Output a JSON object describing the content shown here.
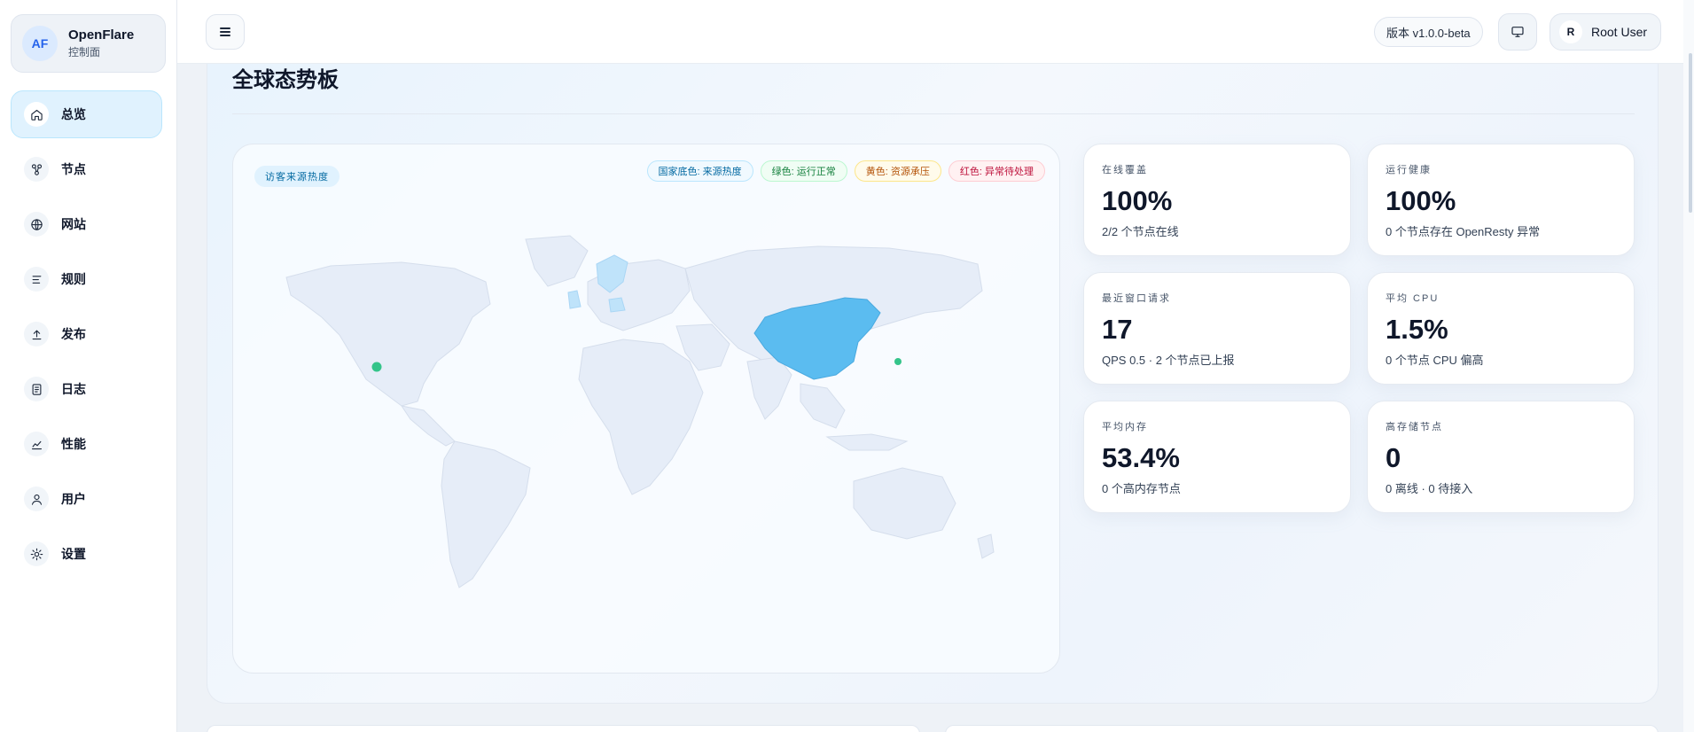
{
  "brand": {
    "avatar": "AF",
    "name": "OpenFlare",
    "subtitle": "控制面"
  },
  "sidebar": {
    "items": [
      {
        "label": "总览",
        "icon": "home-icon",
        "active": true
      },
      {
        "label": "节点",
        "icon": "nodes-icon"
      },
      {
        "label": "网站",
        "icon": "globe-icon"
      },
      {
        "label": "规则",
        "icon": "list-icon"
      },
      {
        "label": "发布",
        "icon": "upload-icon"
      },
      {
        "label": "日志",
        "icon": "document-icon"
      },
      {
        "label": "性能",
        "icon": "chart-line-icon"
      },
      {
        "label": "用户",
        "icon": "user-icon"
      },
      {
        "label": "设置",
        "icon": "gear-icon"
      }
    ]
  },
  "topbar": {
    "menu_icon": "hamburger-icon",
    "version": "版本 v1.0.0-beta",
    "monitor_icon": "monitor-icon",
    "user": {
      "initial": "R",
      "name": "Root User"
    }
  },
  "dashboard": {
    "title": "全球态势板",
    "map": {
      "badge": "访客来源热度",
      "legend": [
        {
          "label": "国家底色: 来源热度",
          "color": "#0369a1"
        },
        {
          "label": "绿色: 运行正常",
          "color": "#15803d"
        },
        {
          "label": "黄色: 资源承压",
          "color": "#b45309"
        },
        {
          "label": "红色: 异常待处理",
          "color": "#be123c"
        }
      ],
      "highlight_color": "#5bbcf0",
      "node_color": "#34c48a"
    },
    "stats": [
      {
        "label": "在线覆盖",
        "value": "100%",
        "desc": "2/2 个节点在线"
      },
      {
        "label": "运行健康",
        "value": "100%",
        "desc": "0 个节点存在 OpenResty 异常"
      },
      {
        "label": "最近窗口请求",
        "value": "17",
        "desc": "QPS 0.5 · 2 个节点已上报"
      },
      {
        "label": "平均 CPU",
        "value": "1.5%",
        "desc": "0 个节点 CPU 偏高"
      },
      {
        "label": "平均内存",
        "value": "53.4%",
        "desc": "0 个高内存节点"
      },
      {
        "label": "高存储节点",
        "value": "0",
        "desc": "0 离线 · 0 待接入"
      }
    ]
  }
}
